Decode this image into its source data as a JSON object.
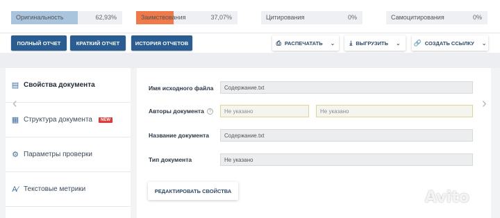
{
  "stats": [
    {
      "label": "Оригинальность",
      "value": "62,93%",
      "fill": 0.6,
      "color": "#a9c4dd"
    },
    {
      "label": "Заимствования",
      "value": "37,07%",
      "fill": 0.37,
      "color": "#f0794a"
    },
    {
      "label": "Цитирования",
      "value": "0%",
      "fill": 0,
      "color": "#a9c4dd"
    },
    {
      "label": "Самоцитирования",
      "value": "0%",
      "fill": 0,
      "color": "#a9c4dd"
    }
  ],
  "actions": {
    "full_report": "ПОЛНЫЙ ОТЧЕТ",
    "short_report": "КРАТКИЙ ОТЧЕТ",
    "report_history": "ИСТОРИЯ ОТЧЕТОВ",
    "print": "РАСПЕЧАТАТЬ",
    "export": "ВЫГРУЗИТЬ",
    "create_link": "СОЗДАТЬ ССЫЛКУ"
  },
  "sidebar": {
    "items": [
      {
        "label": "Свойства документа",
        "icon": "document-icon"
      },
      {
        "label": "Структура документа",
        "icon": "structure-icon",
        "badge": "NEW"
      },
      {
        "label": "Параметры проверки",
        "icon": "gear-icon"
      },
      {
        "label": "Текстовые метрики",
        "icon": "text-metrics-icon"
      }
    ]
  },
  "form": {
    "filename_label": "Имя исходного файла",
    "filename_value": "Содержание.txt",
    "authors_label": "Авторы документа",
    "author1_placeholder": "Не указано",
    "author2_placeholder": "Не указано",
    "title_label": "Название документа",
    "title_value": "Содержание.txt",
    "type_label": "Тип документа",
    "type_value": "Не указано",
    "edit_button": "РЕДАКТИРОВАТЬ СВОЙСТВА"
  },
  "watermark": "Avito"
}
